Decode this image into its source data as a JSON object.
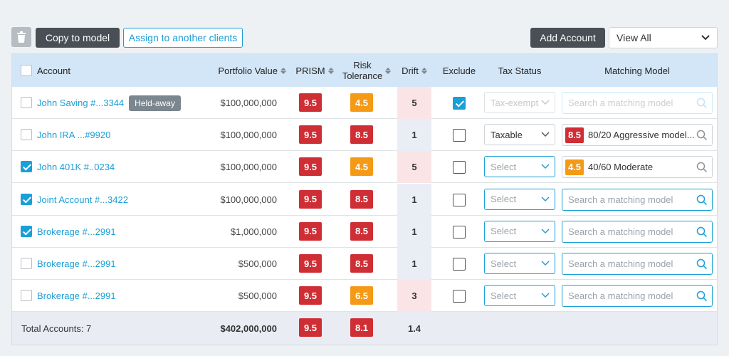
{
  "toolbar": {
    "delete_icon": "trash-icon",
    "copy_label": "Copy to model",
    "assign_label": "Assign to another clients",
    "add_label": "Add Account",
    "view_selected": "View All"
  },
  "headers": {
    "account": "Account",
    "portfolio_value": "Portfolio Value",
    "prism": "PRISM",
    "risk_line1": "Risk",
    "risk_line2": "Tolerance",
    "drift": "Drift",
    "exclude": "Exclude",
    "tax_status": "Tax Status",
    "matching_model": "Matching Model"
  },
  "colors": {
    "red": "#cf2e35",
    "orange": "#f59a16",
    "accent": "#1a9fd8",
    "drift_high": "#fbe4e6",
    "drift_low": "#e8eef4"
  },
  "rows": [
    {
      "checked": false,
      "name": "John Saving #...3344",
      "tag": "Held-away",
      "value": "$100,000,000",
      "prism": "9.5",
      "prism_color": "red",
      "risk": "4.5",
      "risk_color": "orange",
      "drift": "5",
      "drift_level": "high",
      "exclude": true,
      "tax": "Tax-exempt",
      "tax_state": "disabled",
      "model": "Search a matching model",
      "model_state": "disabled",
      "model_badge": "",
      "model_badge_color": ""
    },
    {
      "checked": false,
      "name": "John IRA ...#9920",
      "tag": "",
      "value": "$100,000,000",
      "prism": "9.5",
      "prism_color": "red",
      "risk": "8.5",
      "risk_color": "red",
      "drift": "1",
      "drift_level": "low",
      "exclude": false,
      "tax": "Taxable",
      "tax_state": "filled",
      "model": "80/20 Aggressive model...",
      "model_state": "filled",
      "model_badge": "8.5",
      "model_badge_color": "red"
    },
    {
      "checked": true,
      "name": "John 401K #..0234",
      "tag": "",
      "value": "$100,000,000",
      "prism": "9.5",
      "prism_color": "red",
      "risk": "4.5",
      "risk_color": "orange",
      "drift": "5",
      "drift_level": "high",
      "exclude": false,
      "tax": "Select",
      "tax_state": "empty",
      "model": "40/60 Moderate",
      "model_state": "filled",
      "model_badge": "4.5",
      "model_badge_color": "orange"
    },
    {
      "checked": true,
      "name": "Joint Account #...3422",
      "tag": "",
      "value": "$100,000,000",
      "prism": "9.5",
      "prism_color": "red",
      "risk": "8.5",
      "risk_color": "red",
      "drift": "1",
      "drift_level": "low",
      "exclude": false,
      "tax": "Select",
      "tax_state": "empty",
      "model": "Search a matching model",
      "model_state": "empty",
      "model_badge": "",
      "model_badge_color": ""
    },
    {
      "checked": true,
      "name": "Brokerage #...2991",
      "tag": "",
      "value": "$1,000,000",
      "prism": "9.5",
      "prism_color": "red",
      "risk": "8.5",
      "risk_color": "red",
      "drift": "1",
      "drift_level": "low",
      "exclude": false,
      "tax": "Select",
      "tax_state": "empty",
      "model": "Search a matching model",
      "model_state": "empty",
      "model_badge": "",
      "model_badge_color": ""
    },
    {
      "checked": false,
      "name": "Brokerage #...2991",
      "tag": "",
      "value": "$500,000",
      "prism": "9.5",
      "prism_color": "red",
      "risk": "8.5",
      "risk_color": "red",
      "drift": "1",
      "drift_level": "low",
      "exclude": false,
      "tax": "Select",
      "tax_state": "empty",
      "model": "Search a matching model",
      "model_state": "empty",
      "model_badge": "",
      "model_badge_color": ""
    },
    {
      "checked": false,
      "name": "Brokerage #...2991",
      "tag": "",
      "value": "$500,000",
      "prism": "9.5",
      "prism_color": "red",
      "risk": "6.5",
      "risk_color": "orange",
      "drift": "3",
      "drift_level": "high",
      "exclude": false,
      "tax": "Select",
      "tax_state": "empty",
      "model": "Search a matching model",
      "model_state": "empty",
      "model_badge": "",
      "model_badge_color": ""
    }
  ],
  "footer": {
    "total_label": "Total Accounts: 7",
    "total_value": "$402,000,000",
    "prism": "9.5",
    "risk": "8.1",
    "drift": "1.4"
  }
}
